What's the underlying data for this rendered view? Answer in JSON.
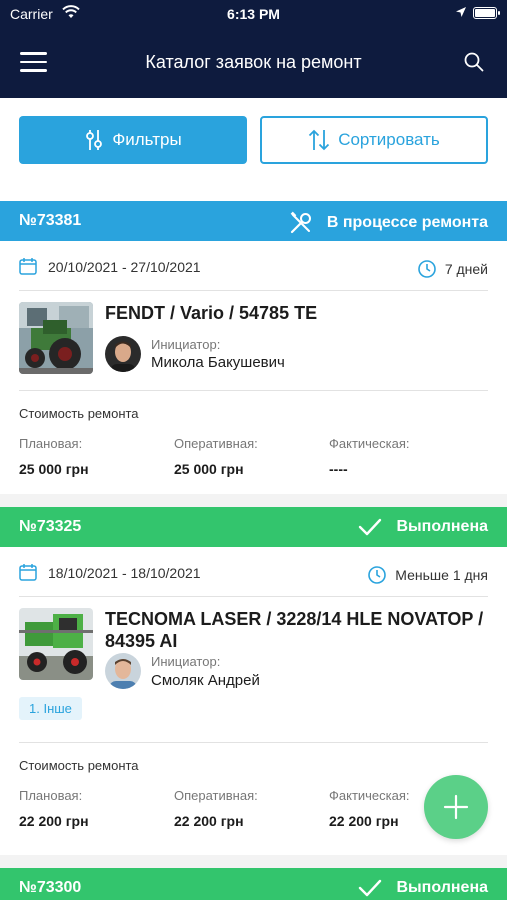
{
  "status_bar": {
    "carrier": "Carrier",
    "time": "6:13 PM"
  },
  "header": {
    "title": "Каталог заявок на ремонт"
  },
  "actions": {
    "filter_label": "Фильтры",
    "sort_label": "Сортировать"
  },
  "colors": {
    "navy": "#0e1b3e",
    "accent_blue": "#2aa3dd",
    "done_green": "#33c56d"
  },
  "orders": [
    {
      "number": "№73381",
      "status": "В процессе ремонта",
      "status_icon": "wrench-screwdriver-icon",
      "dates": "20/10/2021 - 27/10/2021",
      "duration": "7 дней",
      "machine": "FENDT / Vario / 54785 TE",
      "initiator_label": "Инициатор:",
      "initiator": "Микола Бакушевич",
      "cost_label": "Стоимость ремонта",
      "planned_label": "Плановая:",
      "planned": "25 000 грн",
      "operational_label": "Оперативная:",
      "operational": "25 000 грн",
      "actual_label": "Фактическая:",
      "actual": "----"
    },
    {
      "number": "№73325",
      "status": "Выполнена",
      "status_icon": "checkmark-icon",
      "dates": "18/10/2021 - 18/10/2021",
      "duration": "Меньше 1 дня",
      "machine": "TECNOMA LASER / 3228/14 HLE NOVATOP / 84395 AI",
      "initiator_label": "Инициатор:",
      "initiator": "Смоляк Андрей",
      "tag": "1. Інше",
      "cost_label": "Стоимость ремонта",
      "planned_label": "Плановая:",
      "planned": "22 200 грн",
      "operational_label": "Оперативная:",
      "operational": "22 200 грн",
      "actual_label": "Фактическая:",
      "actual": "22 200 грн"
    },
    {
      "number": "№73300",
      "status": "Выполнена",
      "status_icon": "checkmark-icon"
    }
  ]
}
